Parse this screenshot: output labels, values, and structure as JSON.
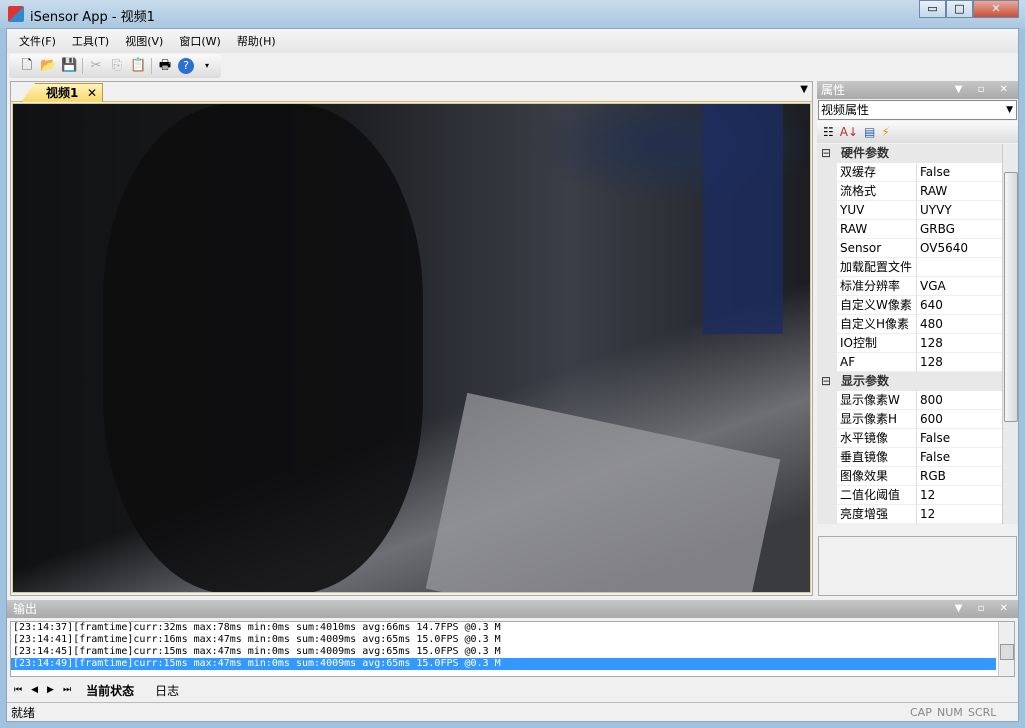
{
  "window": {
    "title": "iSensor App - 视频1",
    "minimize": "▭",
    "maximize": "□",
    "close": "✕"
  },
  "menu": [
    "文件(F)",
    "工具(T)",
    "视图(V)",
    "窗口(W)",
    "帮助(H)"
  ],
  "toolbar": {
    "icons": [
      "new-file-icon",
      "open-folder-icon",
      "save-icon",
      "cut-icon",
      "copy-icon",
      "paste-icon",
      "print-icon",
      "help-icon"
    ]
  },
  "document": {
    "tab_label": "视频1",
    "tab_close": "✕",
    "dropdown": "▼"
  },
  "properties": {
    "title": "属性",
    "selector": "视频属性",
    "categories": [
      {
        "name": "硬件参数",
        "rows": [
          [
            "双缓存",
            "False"
          ],
          [
            "流格式",
            "RAW"
          ],
          [
            "YUV",
            "UYVY"
          ],
          [
            "RAW",
            "GRBG"
          ],
          [
            "Sensor",
            "OV5640"
          ],
          [
            "加载配置文件",
            ""
          ],
          [
            "标准分辨率",
            "VGA"
          ],
          [
            "自定义W像素",
            "640"
          ],
          [
            "自定义H像素",
            "480"
          ],
          [
            "IO控制",
            "128"
          ],
          [
            "AF",
            "128"
          ]
        ]
      },
      {
        "name": "显示参数",
        "rows": [
          [
            "显示像素W",
            "800"
          ],
          [
            "显示像素H",
            "600"
          ],
          [
            "水平镜像",
            "False"
          ],
          [
            "垂直镜像",
            "False"
          ],
          [
            "图像效果",
            "RGB"
          ],
          [
            "二值化阈值",
            "12"
          ],
          [
            "亮度增强",
            "12"
          ]
        ]
      }
    ]
  },
  "output": {
    "title": "输出",
    "lines": [
      "[23:14:37][framtime]curr:32ms max:78ms min:0ms sum:4010ms avg:66ms 14.7FPS @0.3 M",
      "[23:14:41][framtime]curr:16ms max:47ms min:0ms sum:4009ms avg:65ms 15.0FPS @0.3 M",
      "[23:14:45][framtime]curr:15ms max:47ms min:0ms sum:4009ms avg:65ms 15.0FPS @0.3 M",
      "[23:14:49][framtime]curr:15ms max:47ms min:0ms sum:4009ms avg:65ms 15.0FPS @0.3 M"
    ],
    "selected_index": 3,
    "tabs": [
      "当前状态",
      "日志"
    ]
  },
  "status": {
    "text": "就绪",
    "cap": "CAP",
    "num": "NUM",
    "scrl": "SCRL"
  }
}
